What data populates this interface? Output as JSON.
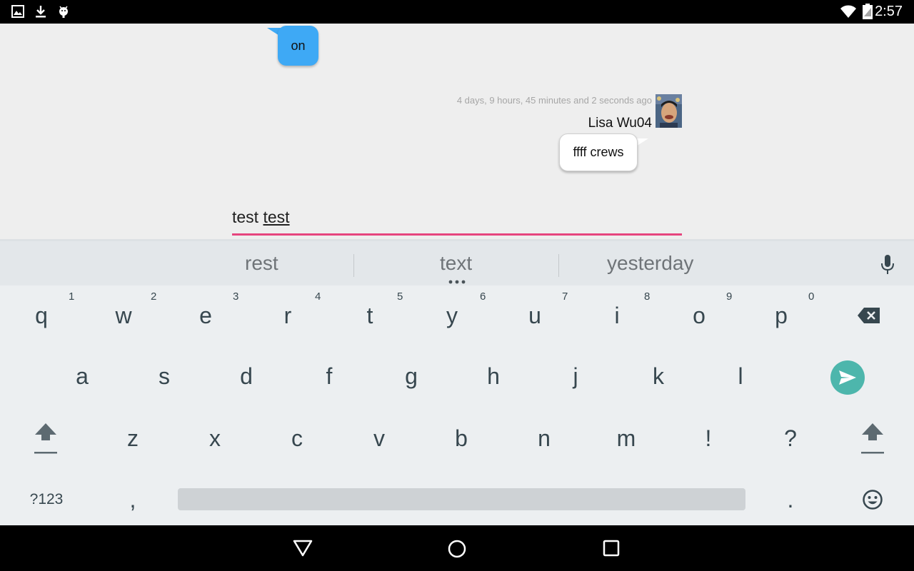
{
  "status_bar": {
    "time": "2:57",
    "icons_left": [
      "image-icon",
      "download-icon",
      "android-icon"
    ],
    "icons_right": [
      "wifi-icon",
      "battery-icon"
    ]
  },
  "chat": {
    "incoming_message": "on",
    "outgoing": {
      "timestamp": "4 days, 9 hours, 45 minutes and 2 seconds ago",
      "sender": "Lisa Wu04",
      "message": "ffff crews"
    },
    "input": {
      "text_plain": "test ",
      "text_composing": "test"
    }
  },
  "keyboard": {
    "suggestions": [
      "rest",
      "text",
      "yesterday"
    ],
    "row1": [
      "q",
      "w",
      "e",
      "r",
      "t",
      "y",
      "u",
      "i",
      "o",
      "p"
    ],
    "row1_hints": [
      "1",
      "2",
      "3",
      "4",
      "5",
      "6",
      "7",
      "8",
      "9",
      "0"
    ],
    "row2": [
      "a",
      "s",
      "d",
      "f",
      "g",
      "h",
      "j",
      "k",
      "l"
    ],
    "row3": [
      "z",
      "x",
      "c",
      "v",
      "b",
      "n",
      "m",
      "!",
      "?"
    ],
    "symbols_key": "?123",
    "comma_key": ",",
    "period_key": ".",
    "accent_color": "#4db6ac"
  },
  "nav": {
    "buttons": [
      "back-icon",
      "home-icon",
      "recents-icon"
    ]
  },
  "colors": {
    "incoming_bubble": "#3ea9f5",
    "input_underline": "#e6457e"
  }
}
